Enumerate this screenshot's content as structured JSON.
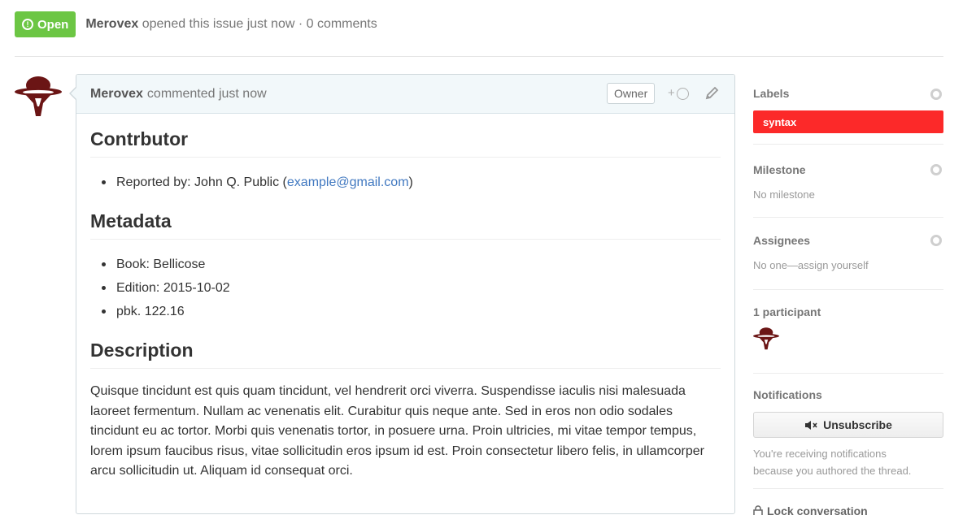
{
  "issue": {
    "state_label": "Open",
    "author": "Merovex",
    "meta_text": "opened this issue just now · 0 comments"
  },
  "comment": {
    "author": "Merovex",
    "time_text": "commented just now",
    "owner_badge": "Owner",
    "reaction_plus": "+",
    "sections": {
      "contributor_heading": "Contrbutor",
      "reported_by": "Reported by: John Q. Public (",
      "email": "example@gmail.com",
      "reported_by_end": ")",
      "metadata_heading": "Metadata",
      "metadata_items": [
        "Book: Bellicose",
        "Edition: 2015-10-02",
        "pbk. 122.16"
      ],
      "description_heading": "Description",
      "description": "Quisque tincidunt est quis quam tincidunt, vel hendrerit orci viverra. Suspendisse iaculis nisi malesuada laoreet fermentum. Nullam ac venenatis elit. Curabitur quis neque ante. Sed in eros non odio sodales tincidunt eu ac tortor. Morbi quis venenatis tortor, in posuere urna. Proin ultricies, mi vitae tempor tempus, lorem ipsum faucibus risus, vitae sollicitudin eros ipsum id est. Proin consectetur libero felis, in ullamcorper arcu sollicitudin ut. Aliquam id consequat orci."
    }
  },
  "sidebar": {
    "labels_title": "Labels",
    "label_name": "syntax",
    "milestone_title": "Milestone",
    "milestone_value": "No milestone",
    "assignees_title": "Assignees",
    "assignees_value": "No one—assign yourself",
    "participants_title": "1 participant",
    "notifications_title": "Notifications",
    "unsubscribe_label": "Unsubscribe",
    "notif_text_1": "You're receiving notifications",
    "notif_text_2": "because you authored the thread.",
    "lock_label": "Lock conversation"
  },
  "colors": {
    "open_badge": "#6cc644",
    "label_syntax": "#fc2929",
    "avatar": "#6b1515",
    "link": "#4078c0"
  },
  "icons": [
    "issue-opened-icon",
    "smiley-icon",
    "pencil-icon",
    "gear-icon",
    "mute-icon",
    "lock-icon",
    "avatar-logo"
  ]
}
